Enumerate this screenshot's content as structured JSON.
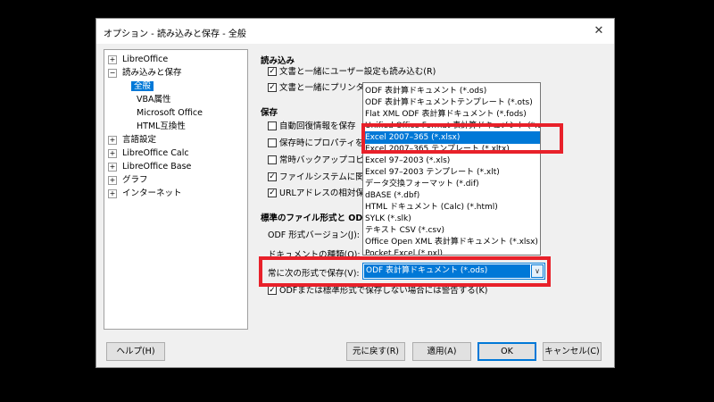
{
  "dialog": {
    "title": "オプション - 読み込みと保存 - 全般",
    "close_glyph": "✕"
  },
  "tree": {
    "libreoffice": "LibreOffice",
    "load_save": "読み込みと保存",
    "general": "全般",
    "vba": "VBA属性",
    "msoffice": "Microsoft Office",
    "html": "HTML互換性",
    "lang": "言語設定",
    "calc": "LibreOffice Calc",
    "base": "LibreOffice Base",
    "graph": "グラフ",
    "internet": "インターネット",
    "plus": "+",
    "minus": "−"
  },
  "load": {
    "heading": "読み込み",
    "opt1": "文書と一緒にユーザー設定も読み込む(R)",
    "opt2": "文書と一緒にプリンター設"
  },
  "save": {
    "heading": "保存",
    "opt1": "自動回復情報を保存",
    "opt2": "保存時にプロパティを",
    "opt3": "常時バックアップコピーの作",
    "opt4": "ファイルシステムに関連し",
    "opt5": "URLアドレスの相対保存"
  },
  "odf": {
    "heading": "標準のファイル形式と ODF 設",
    "version_label": "ODF 形式バージョン(J):",
    "doctype_label": "ドキュメントの種類(O):",
    "always_label": "常に次の形式で保存(V):",
    "selected": "ODF 表計算ドキュメント (*.ods)",
    "warn": "ODFまたは標準形式で保存しない場合には警告する(K)"
  },
  "dropdown_options": [
    "ODF 表計算ドキュメント (*.ods)",
    "ODF 表計算ドキュメントテンプレート (*.ots)",
    "Flat XML ODF 表計算ドキュメント (*.fods)",
    "Unified Office Format 表計算ドキュメント (*.uos)",
    "Excel 2007–365 (*.xlsx)",
    "Excel 2007–365 テンプレート (*.xltx)",
    "Excel 97–2003 (*.xls)",
    "Excel 97–2003 テンプレート (*.xlt)",
    "データ交換フォーマット (*.dif)",
    "dBASE (*.dbf)",
    "HTML ドキュメント (Calc) (*.html)",
    "SYLK (*.slk)",
    "テキスト CSV (*.csv)",
    "Office Open XML 表計算ドキュメント (*.xlsx)",
    "Pocket Excel (*.pxl)"
  ],
  "highlighted_index": 4,
  "buttons": {
    "help": "ヘルプ(H)",
    "reset": "元に戻す(R)",
    "apply": "適用(A)",
    "ok": "OK",
    "cancel": "キャンセル(C)"
  },
  "glyphs": {
    "check": "✓",
    "chevron": "∨"
  },
  "colors": {
    "accent": "#0078d7",
    "highlight_box": "#e8212a"
  }
}
